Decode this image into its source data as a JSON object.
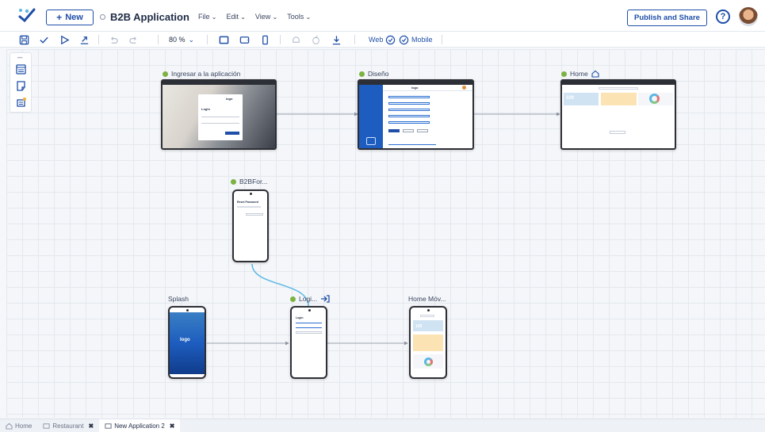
{
  "header": {
    "new_label": "New",
    "app_title": "B2B Application",
    "menus": [
      "File",
      "Edit",
      "View",
      "Tools"
    ],
    "publish_label": "Publish and Share",
    "help_label": "?"
  },
  "toolbar": {
    "zoom": "80 %",
    "web_label": "Web",
    "mobile_label": "Mobile"
  },
  "nodes": {
    "login_web": "Ingresar a la aplicación",
    "diseno": "Diseño",
    "home": "Home",
    "b2bfor": "B2BFor...",
    "splash": "Splash",
    "login_mobile": "Logi...",
    "home_mobile": "Home Móv..."
  },
  "previews": {
    "login_title": "Login",
    "logo_text": "logo",
    "home_kpi": "100",
    "password_title": "Reset Password"
  },
  "tabs": [
    {
      "label": "Home"
    },
    {
      "label": "Restaurant"
    },
    {
      "label": "New Application 2"
    }
  ],
  "colors": {
    "accent": "#1f4fa8",
    "node_status": "#7cb342",
    "connector": "#5bb7e5"
  }
}
